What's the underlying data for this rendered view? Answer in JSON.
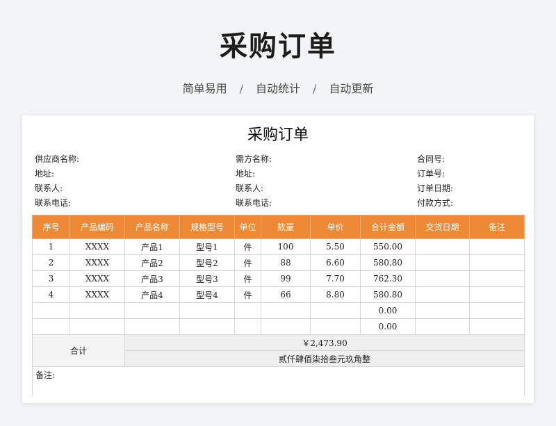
{
  "header": {
    "title": "采购订单",
    "subtitle": [
      "简单易用",
      "自动统计",
      "自动更新"
    ],
    "separator": "/"
  },
  "document": {
    "title": "采购订单",
    "info_col1": [
      "供应商名称:",
      "地址:",
      "联系人:",
      "联系电话:"
    ],
    "info_col2": [
      "需方名称:",
      "地址:",
      "联系人:",
      "联系电话:"
    ],
    "info_col3": [
      "合同号:",
      "订单号:",
      "订单日期:",
      "付款方式:"
    ]
  },
  "table": {
    "headers": [
      "序号",
      "产品编码",
      "产品名称",
      "规格型号",
      "单位",
      "数量",
      "单价",
      "合计金额",
      "交货日期",
      "备注"
    ],
    "rows": [
      [
        "1",
        "XXXX",
        "产品1",
        "型号1",
        "件",
        "100",
        "5.50",
        "550.00",
        "",
        ""
      ],
      [
        "2",
        "XXXX",
        "产品2",
        "型号2",
        "件",
        "88",
        "6.60",
        "580.80",
        "",
        ""
      ],
      [
        "3",
        "XXXX",
        "产品3",
        "型号3",
        "件",
        "99",
        "7.70",
        "762.30",
        "",
        ""
      ],
      [
        "4",
        "XXXX",
        "产品4",
        "型号4",
        "件",
        "66",
        "8.80",
        "580.80",
        "",
        ""
      ],
      [
        "",
        "",
        "",
        "",
        "",
        "",
        "",
        "0.00",
        "",
        ""
      ],
      [
        "",
        "",
        "",
        "",
        "",
        "",
        "",
        "0.00",
        "",
        ""
      ]
    ],
    "total_label": "合计",
    "total_amount": "￥2,473.90",
    "total_uppercase": "贰仟肆佰柒拾叁元玖角整",
    "remarks_label": "备注:"
  },
  "colors": {
    "header_bg": "#ee8a36",
    "page_bg": "#f3f4f6"
  }
}
